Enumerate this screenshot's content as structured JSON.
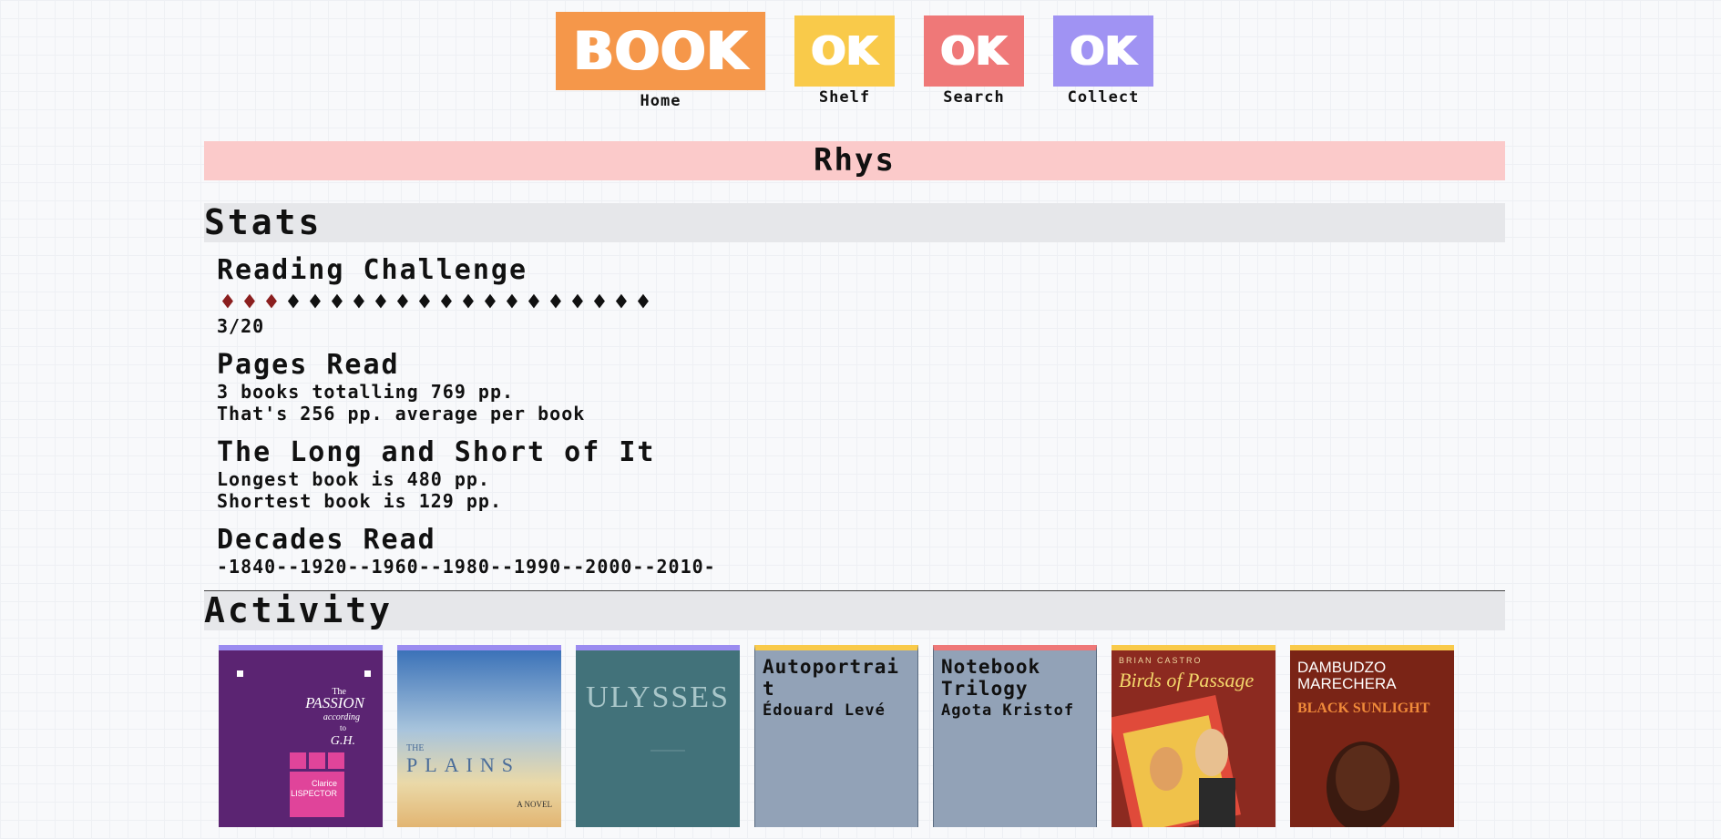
{
  "nav": {
    "home": {
      "tile": "BOOK",
      "label": "Home",
      "color": "#f5974a"
    },
    "shelf": {
      "tile": "OK",
      "label": "Shelf",
      "color": "#f9ca4a"
    },
    "search": {
      "tile": "OK",
      "label": "Search",
      "color": "#ef7878"
    },
    "collect": {
      "tile": "OK",
      "label": "Collect",
      "color": "#a093f3"
    }
  },
  "user": {
    "name": "Rhys"
  },
  "stats": {
    "heading": "Stats",
    "challenge": {
      "title": "Reading Challenge",
      "completed": 3,
      "goal": 20,
      "progress_text": "3/20"
    },
    "pages": {
      "title": "Pages Read",
      "line1": "3 books totalling 769 pp.",
      "line2": "That's 256 pp. average per book"
    },
    "long_short": {
      "title": "The Long and Short of It",
      "line1": "Longest book is 480 pp.",
      "line2": "Shortest book is 129 pp."
    },
    "decades": {
      "title": "Decades Read",
      "line": "-1840--1920--1960--1980--1990--2000--2010-"
    }
  },
  "activity": {
    "heading": "Activity",
    "books": [
      {
        "cover": "image",
        "name": "passion",
        "cover_text": [
          "The",
          "PASSION",
          "according",
          "to",
          "G.H.",
          "Clarice",
          "LISPECTOR"
        ],
        "accent": "#9b8cf0"
      },
      {
        "cover": "image",
        "name": "plains",
        "cover_text": [
          "THE",
          "PLAINS",
          "A NOVEL"
        ],
        "accent": "#9b8cf0"
      },
      {
        "cover": "image",
        "name": "ulysses",
        "cover_text": [
          "ULYSSES"
        ],
        "accent": "#9b8cf0"
      },
      {
        "cover": "text",
        "title": "Autoportrait",
        "author": "Édouard Levé",
        "accent": "#f9ca4a"
      },
      {
        "cover": "text",
        "title": "Notebook Trilogy",
        "author": "Agota Kristof",
        "accent": "#ef7878"
      },
      {
        "cover": "image",
        "name": "birds",
        "cover_text": [
          "BRIAN CASTRO",
          "Birds of Passage"
        ],
        "accent": "#f9ca4a"
      },
      {
        "cover": "image",
        "name": "sunlight",
        "cover_text": [
          "DAMBUDZO",
          "MARECHERA",
          "BLACK SUNLIGHT"
        ],
        "accent": "#f9ca4a"
      }
    ]
  }
}
